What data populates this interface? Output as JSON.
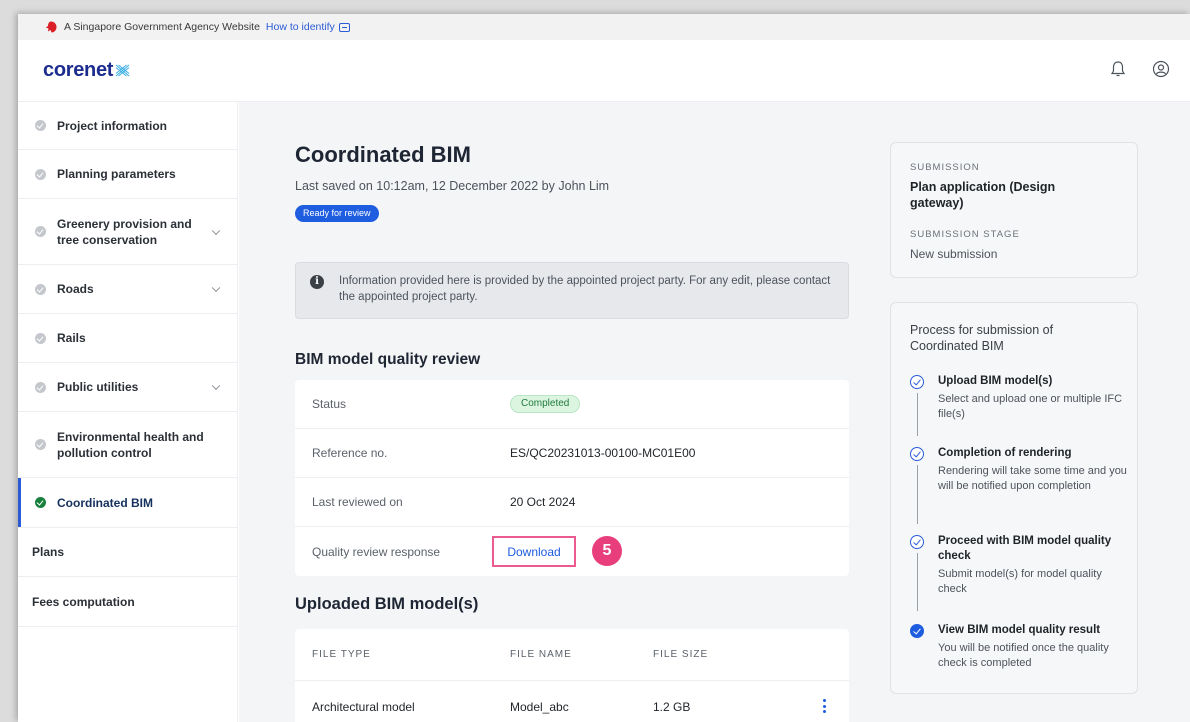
{
  "gov_bar": {
    "text": "A Singapore Government Agency Website",
    "link": "How to identify"
  },
  "header": {
    "logo_text": "corenet",
    "icons": [
      "bell-icon",
      "user-icon"
    ]
  },
  "sidebar": {
    "items": [
      {
        "label": "Project information",
        "checked": true,
        "expandable": false
      },
      {
        "label": "Planning parameters",
        "checked": true,
        "expandable": false
      },
      {
        "label": "Greenery provision and tree conservation",
        "checked": true,
        "expandable": true
      },
      {
        "label": "Roads",
        "checked": true,
        "expandable": true
      },
      {
        "label": "Rails",
        "checked": true,
        "expandable": false
      },
      {
        "label": "Public utilities",
        "checked": true,
        "expandable": true
      },
      {
        "label": "Environmental health and pollution control",
        "checked": true,
        "expandable": false
      },
      {
        "label": "Coordinated BIM",
        "checked": true,
        "expandable": false,
        "active": true
      },
      {
        "label": "Plans"
      },
      {
        "label": "Fees computation"
      }
    ]
  },
  "main": {
    "title": "Coordinated BIM",
    "saved": "Last saved on 10:12am, 12 December 2022 by John Lim",
    "badge": "Ready for review",
    "info": "Information provided here is provided by the appointed project party. For any edit, please contact the appointed project party.",
    "review": {
      "title": "BIM model quality review",
      "rows": [
        {
          "label": "Status",
          "value": "Completed"
        },
        {
          "label": "Reference no.",
          "value": "ES/QC20231013-00100-MC01E00"
        },
        {
          "label": "Last reviewed on",
          "value": "20 Oct 2024"
        },
        {
          "label": "Quality review response",
          "value": "Download"
        }
      ],
      "step_marker": "5"
    },
    "uploaded": {
      "title": "Uploaded BIM model(s)",
      "headers": [
        "FILE TYPE",
        "FILE NAME",
        "FILE SIZE"
      ],
      "rows": [
        {
          "type": "Architectural model",
          "name": "Model_abc",
          "size": "1.2 GB"
        }
      ]
    }
  },
  "submission_panel": {
    "cap1": "SUBMISSION",
    "val1": "Plan application (Design gateway)",
    "cap2": "SUBMISSION STAGE",
    "val2": "New submission"
  },
  "process_panel": {
    "title": "Process for submission of Coordinated BIM",
    "steps": [
      {
        "title": "Upload BIM model(s)",
        "desc": "Select and upload one or multiple IFC file(s)"
      },
      {
        "title": "Completion of rendering",
        "desc": "Rendering will take some time and you will be notified upon completion"
      },
      {
        "title": "Proceed with BIM model quality check",
        "desc": "Submit model(s) for model quality check"
      },
      {
        "title": "View BIM model quality result",
        "desc": "You will be notified once the quality check is completed"
      }
    ]
  },
  "colors": {
    "primary": "#1e5ce0",
    "logo": "#1d2c8f",
    "success": "#17803d",
    "highlight": "#e83e7b"
  }
}
